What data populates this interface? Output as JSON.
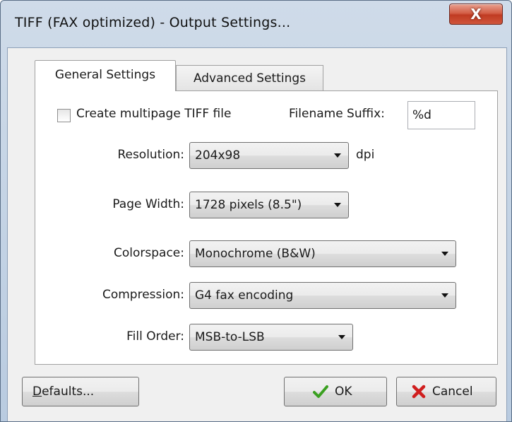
{
  "window": {
    "title": "TIFF (FAX optimized) - Output Settings...",
    "close_glyph": "X"
  },
  "tabs": [
    {
      "label": "General Settings",
      "selected": true
    },
    {
      "label": "Advanced Settings",
      "selected": false
    }
  ],
  "general": {
    "multipage_label": "Create multipage TIFF file",
    "multipage_checked": false,
    "suffix_label": "Filename Suffix:",
    "suffix_value": "%d",
    "resolution_label": "Resolution:",
    "resolution_value": "204x98",
    "resolution_unit": "dpi",
    "page_width_label": "Page Width:",
    "page_width_value": "1728 pixels (8.5\")",
    "colorspace_label": "Colorspace:",
    "colorspace_value": "Monochrome (B&W)",
    "compression_label": "Compression:",
    "compression_value": "G4 fax encoding",
    "fill_order_label": "Fill Order:",
    "fill_order_value": "MSB-to-LSB"
  },
  "buttons": {
    "defaults_accel": "D",
    "defaults_rest": "efaults...",
    "ok_label": "OK",
    "cancel_label": "Cancel"
  },
  "icons": {
    "close": "close-icon",
    "ok": "check-icon",
    "cancel": "x-icon",
    "dropdown": "chevron-down-icon"
  },
  "colors": {
    "title_bar": "#c2d2e4",
    "close_button": "#c94a33",
    "ok_check": "#3aa020",
    "cancel_x": "#d01e1e"
  }
}
